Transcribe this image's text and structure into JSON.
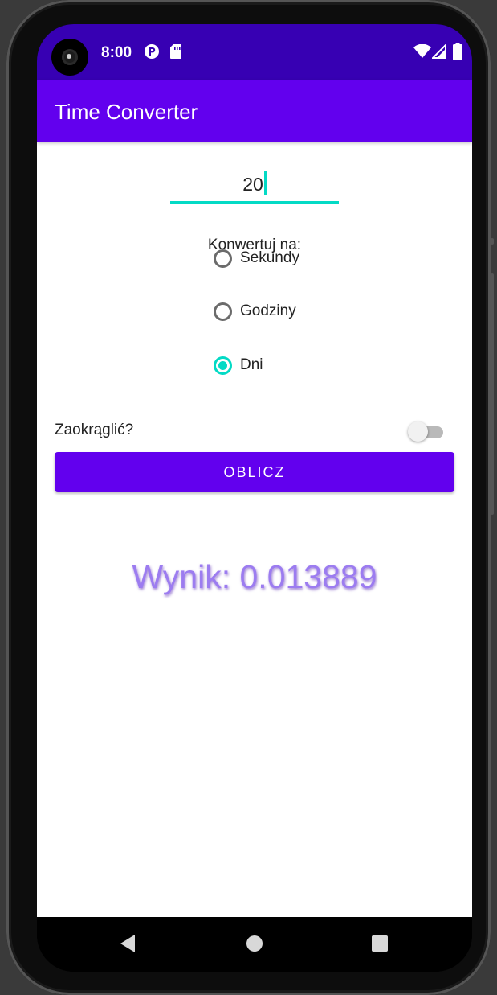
{
  "status_bar": {
    "time": "8:00",
    "left_icons": [
      "p-circle-icon",
      "sd-card-icon"
    ],
    "right_icons": [
      "wifi-icon",
      "signal-icon",
      "battery-icon"
    ],
    "bg_color": "#3700b3"
  },
  "app_bar": {
    "title": "Time Converter",
    "bg_color": "#6200ee"
  },
  "form": {
    "input_value": "20",
    "convert_label": "Konwertuj na:",
    "options": [
      {
        "label": "Sekundy",
        "checked": false
      },
      {
        "label": "Godziny",
        "checked": false
      },
      {
        "label": "Dni",
        "checked": true
      }
    ],
    "round_label": "Zaokrąglić?",
    "round_enabled": false,
    "calculate_button": "OBLICZ",
    "accent_color": "#03dac5"
  },
  "result": {
    "text": "Wynik: 0.013889"
  },
  "nav_bar": {
    "icons": [
      "back-icon",
      "home-icon",
      "recents-icon"
    ]
  }
}
